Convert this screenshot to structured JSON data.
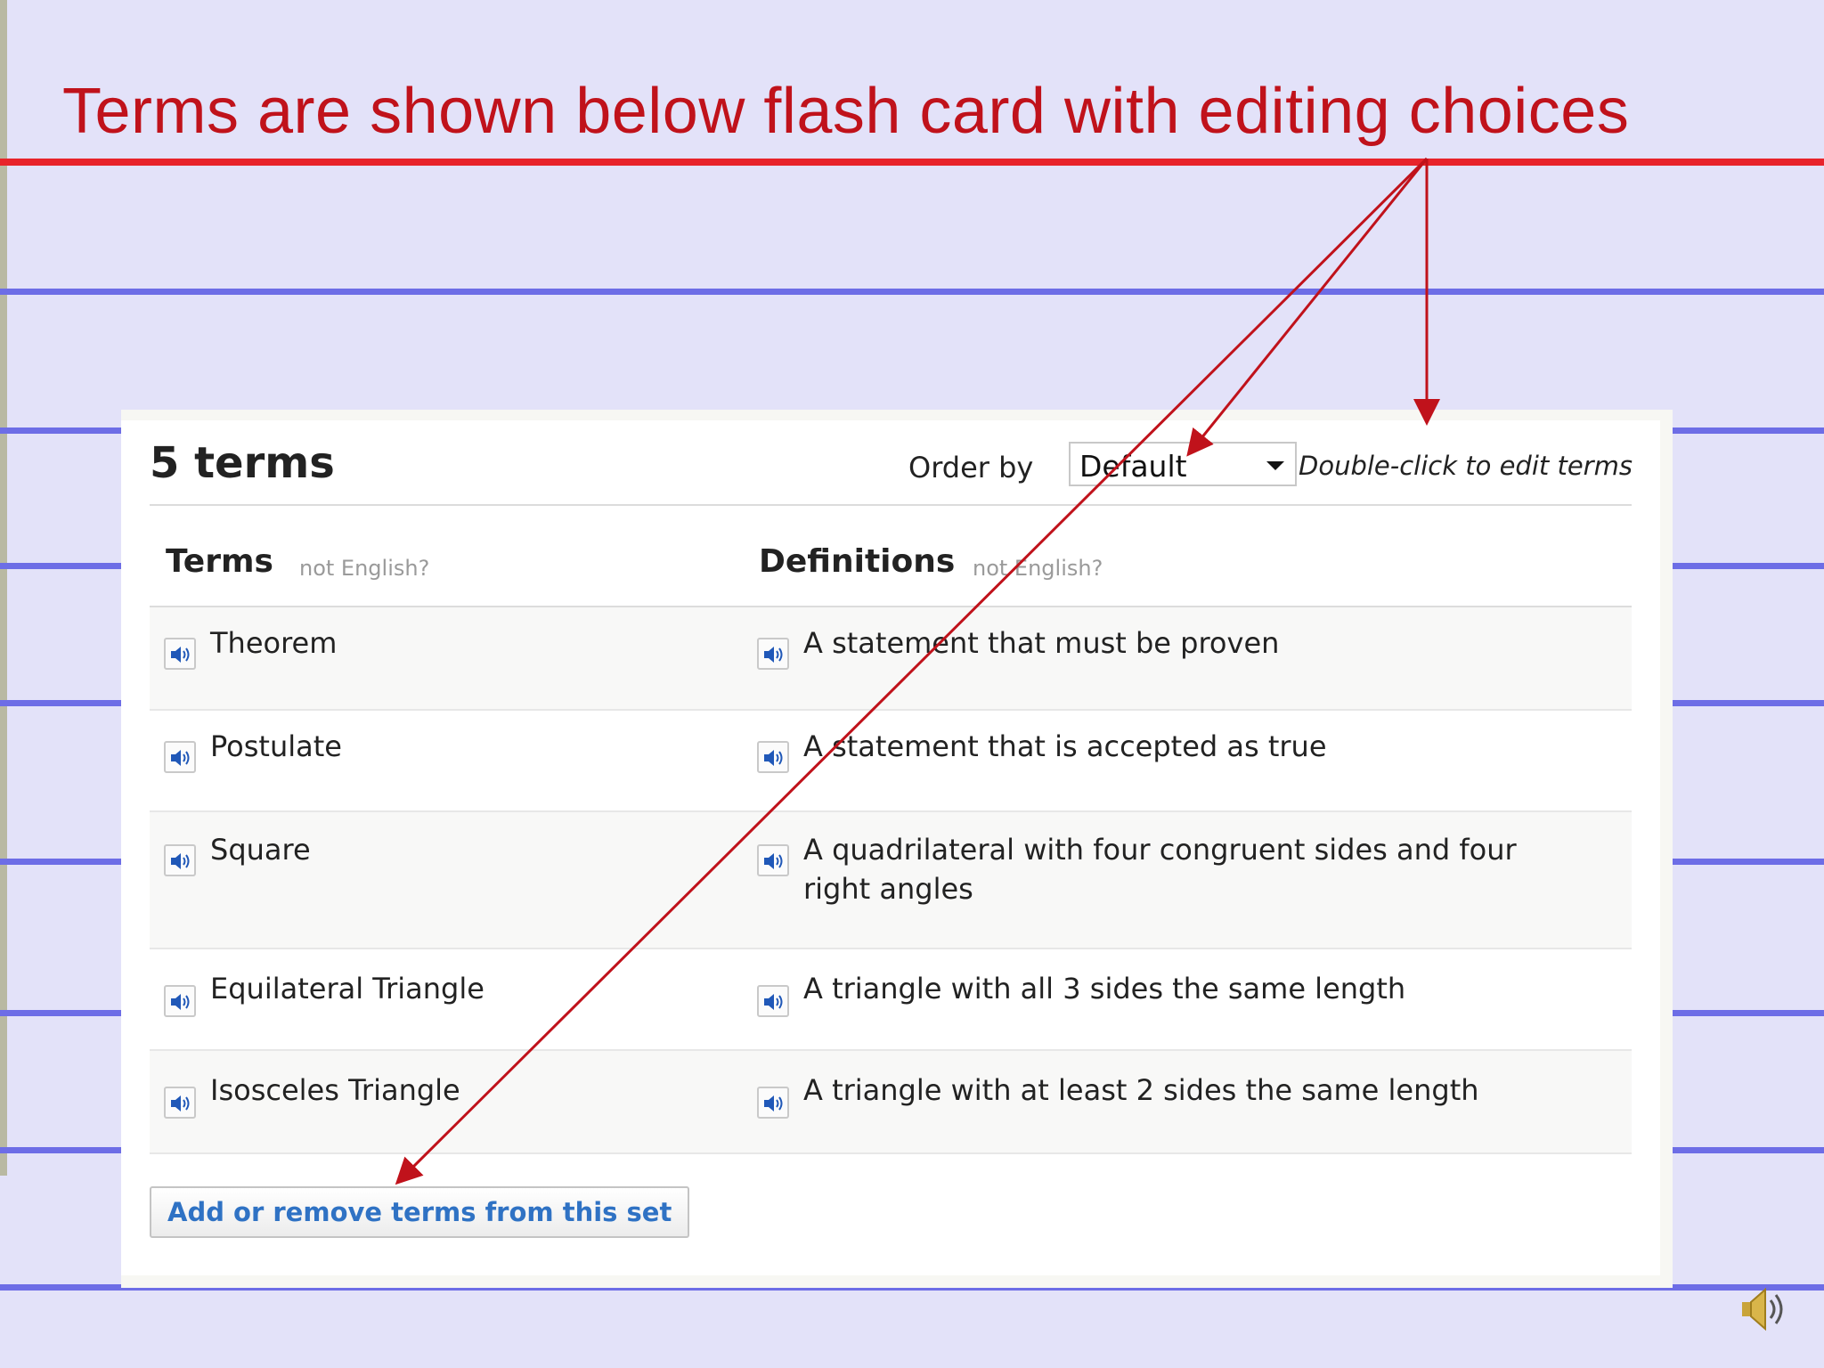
{
  "slide": {
    "title": "Terms are shown below flash card with editing choices",
    "colors": {
      "title": "#c0121b",
      "rule": "#e8232a",
      "lines": "#6d6de6",
      "background": "#e3e2f9",
      "arrow": "#c0121b"
    }
  },
  "panel": {
    "count_label": "5 terms",
    "order_label": "Order by",
    "order_value": "Default",
    "edit_hint": "Double-click to edit terms",
    "terms_header": "Terms",
    "terms_sub": "not English?",
    "defs_header": "Definitions",
    "defs_sub": "not English?",
    "rows": [
      {
        "term": "Theorem",
        "definition": "A statement that must be proven"
      },
      {
        "term": "Postulate",
        "definition": "A statement that is accepted as true"
      },
      {
        "term": "Square",
        "definition": "A quadrilateral with four congruent sides and four right angles"
      },
      {
        "term": "Equilateral Triangle",
        "definition": "A triangle with all 3 sides the same length"
      },
      {
        "term": "Isosceles Triangle",
        "definition": "A triangle with at least 2 sides the same length"
      }
    ],
    "add_button": "Add or remove terms from this set",
    "icons": {
      "audio": "speaker-icon",
      "dropdown": "chevron-down-icon",
      "slide_audio": "sound-icon"
    }
  }
}
